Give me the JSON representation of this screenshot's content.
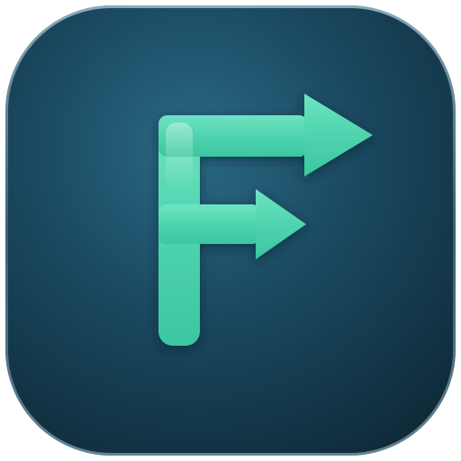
{
  "app_icon": {
    "glyph": "F",
    "icon_name": "forward-arrows-f-logo-icon",
    "colors": {
      "background_center": "#2a6a85",
      "background_mid": "#1b4a62",
      "background_edge": "#0f2b3a",
      "rim_light": "#7fa2b4",
      "glyph_top": "#6fe3c2",
      "glyph_mid": "#4fd4ae",
      "glyph_bottom": "#3cc6a0"
    }
  }
}
